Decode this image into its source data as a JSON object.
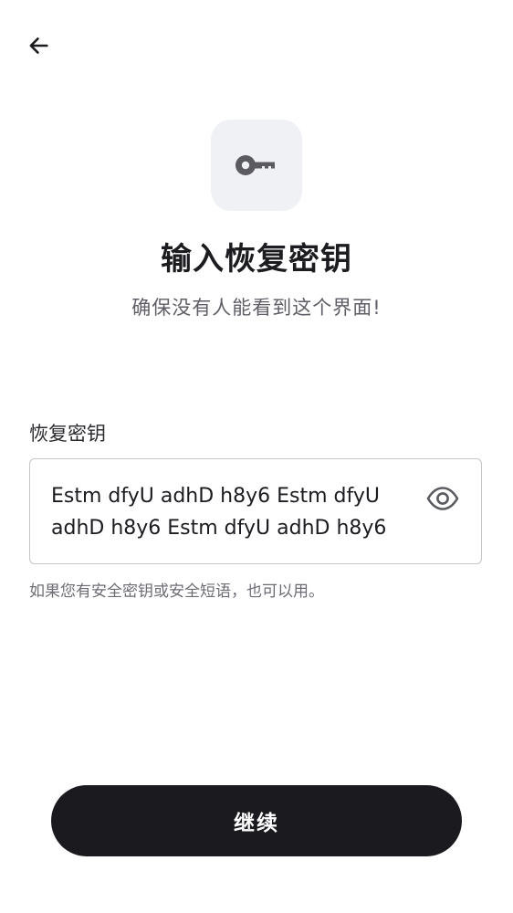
{
  "header": {
    "back_icon": "arrow-left-icon"
  },
  "hero": {
    "icon": "key-icon",
    "title": "输入恢复密钥",
    "subtitle": "确保没有人能看到这个界面!"
  },
  "form": {
    "label": "恢复密钥",
    "value": "Estm dfyU adhD h8y6 Estm dfyU adhD h8y6 Estm dfyU adhD h8y6",
    "visibility_icon": "eye-icon",
    "helper": "如果您有安全密钥或安全短语，也可以用。"
  },
  "footer": {
    "continue_label": "继续"
  },
  "colors": {
    "primary_button": "#1b1b1f",
    "tile_background": "#f0f1f4",
    "icon_gray": "#5a5a60",
    "border": "#c4c4c9"
  }
}
